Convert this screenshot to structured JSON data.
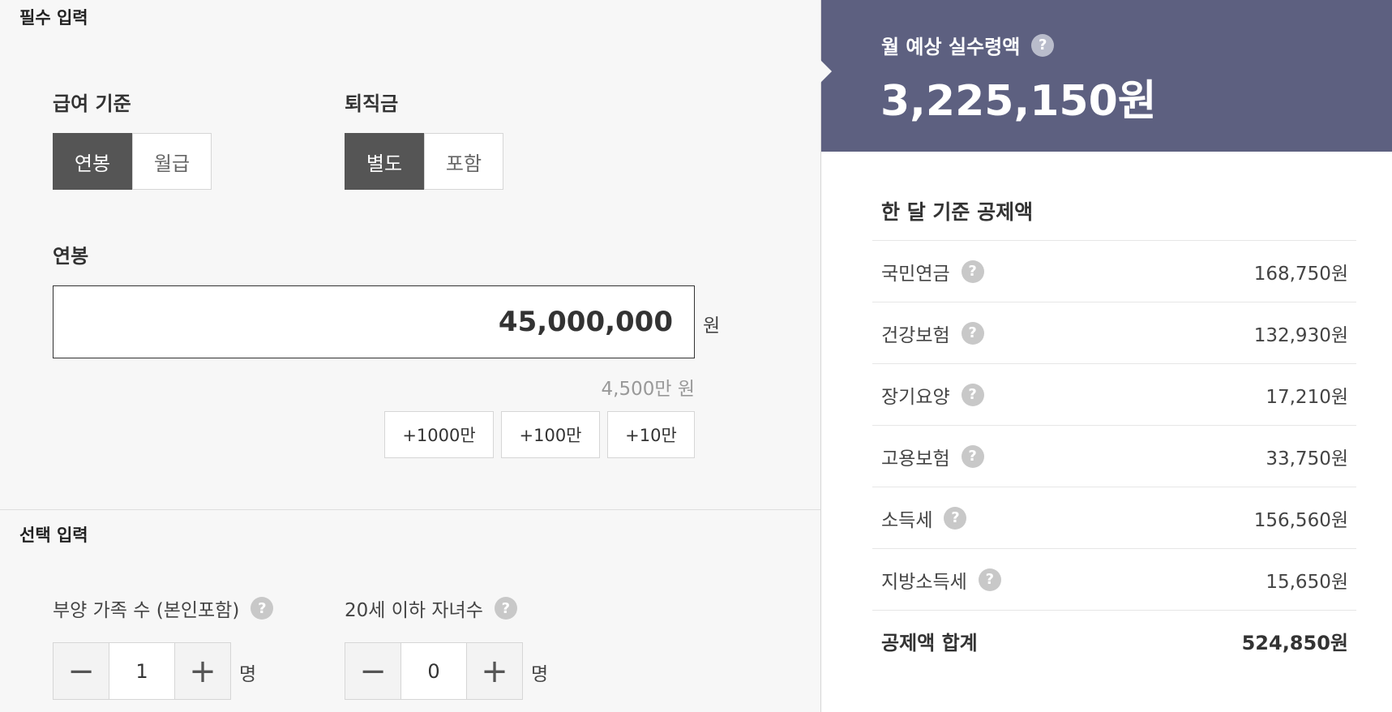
{
  "required": {
    "section_title": "필수 입력",
    "pay_basis": {
      "label": "급여 기준",
      "options": [
        "연봉",
        "월급"
      ],
      "selected": "연봉"
    },
    "severance": {
      "label": "퇴직금",
      "options": [
        "별도",
        "포함"
      ],
      "selected": "별도"
    },
    "salary": {
      "label": "연봉",
      "value": "45,000,000",
      "unit": "원",
      "converted": "4,500만 원",
      "quick_buttons": [
        "+1000만",
        "+100만",
        "+10만"
      ]
    }
  },
  "optional": {
    "section_title": "선택 입력",
    "dependents": {
      "label": "부양 가족 수 (본인포함)",
      "value": "1",
      "unit": "명",
      "minus": "−",
      "plus": "+"
    },
    "children": {
      "label": "20세 이하 자녀수",
      "value": "0",
      "unit": "명",
      "minus": "−",
      "plus": "+"
    }
  },
  "result": {
    "title": "월 예상 실수령액",
    "amount": "3,225,150원",
    "help_icon": "?",
    "deductions_title": "한 달 기준 공제액",
    "deductions": [
      {
        "name": "국민연금",
        "value": "168,750원"
      },
      {
        "name": "건강보험",
        "value": "132,930원"
      },
      {
        "name": "장기요양",
        "value": "17,210원"
      },
      {
        "name": "고용보험",
        "value": "33,750원"
      },
      {
        "name": "소득세",
        "value": "156,560원"
      },
      {
        "name": "지방소득세",
        "value": "15,650원"
      }
    ],
    "total": {
      "name": "공제액 합계",
      "value": "524,850원"
    }
  },
  "colors": {
    "header_bg": "#5d6080",
    "active_btn": "#555555"
  },
  "icons": {
    "help": "question-circle-icon",
    "minus": "minus-icon",
    "plus": "plus-icon"
  }
}
